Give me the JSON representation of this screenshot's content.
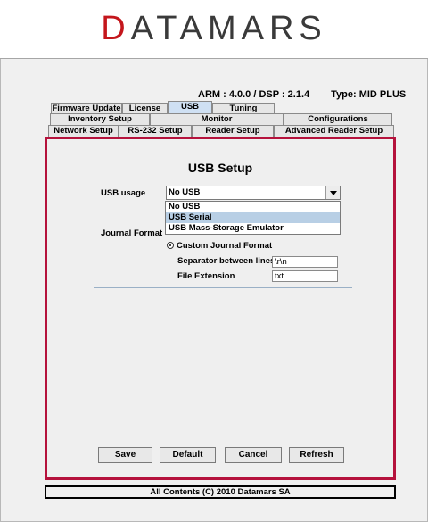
{
  "logo": {
    "prefix": "D",
    "rest": "ATAMARS"
  },
  "version": {
    "arm_dsp": "ARM : 4.0.0 / DSP : 2.1.4",
    "type": "Type: MID PLUS"
  },
  "tabs": {
    "row1": [
      "Firmware Update",
      "License",
      "USB",
      "Tuning"
    ],
    "row2": [
      "Inventory Setup",
      "Monitor",
      "Configurations"
    ],
    "row3": [
      "Network Setup",
      "RS-232 Setup",
      "Reader Setup",
      "Advanced Reader Setup"
    ],
    "selected": "USB"
  },
  "panel": {
    "title": "USB Setup",
    "usb_usage_label": "USB usage",
    "usb_usage_value": "No USB",
    "usb_options": [
      "No USB",
      "USB Serial",
      "USB Mass-Storage Emulator"
    ],
    "highlighted_option": "USB Serial",
    "journal_format_label": "Journal Format",
    "custom_journal_label": "Custom Journal Format",
    "separator_label": "Separator between lines",
    "separator_value": "\\r\\n",
    "file_ext_label": "File Extension",
    "file_ext_value": "txt"
  },
  "buttons": {
    "save": "Save",
    "default": "Default",
    "cancel": "Cancel",
    "refresh": "Refresh"
  },
  "footer": "All Contents (C) 2010 Datamars SA",
  "colors": {
    "accent_border": "#b5123c",
    "logo_red": "#c4161c",
    "selection": "#b8cfe5"
  }
}
